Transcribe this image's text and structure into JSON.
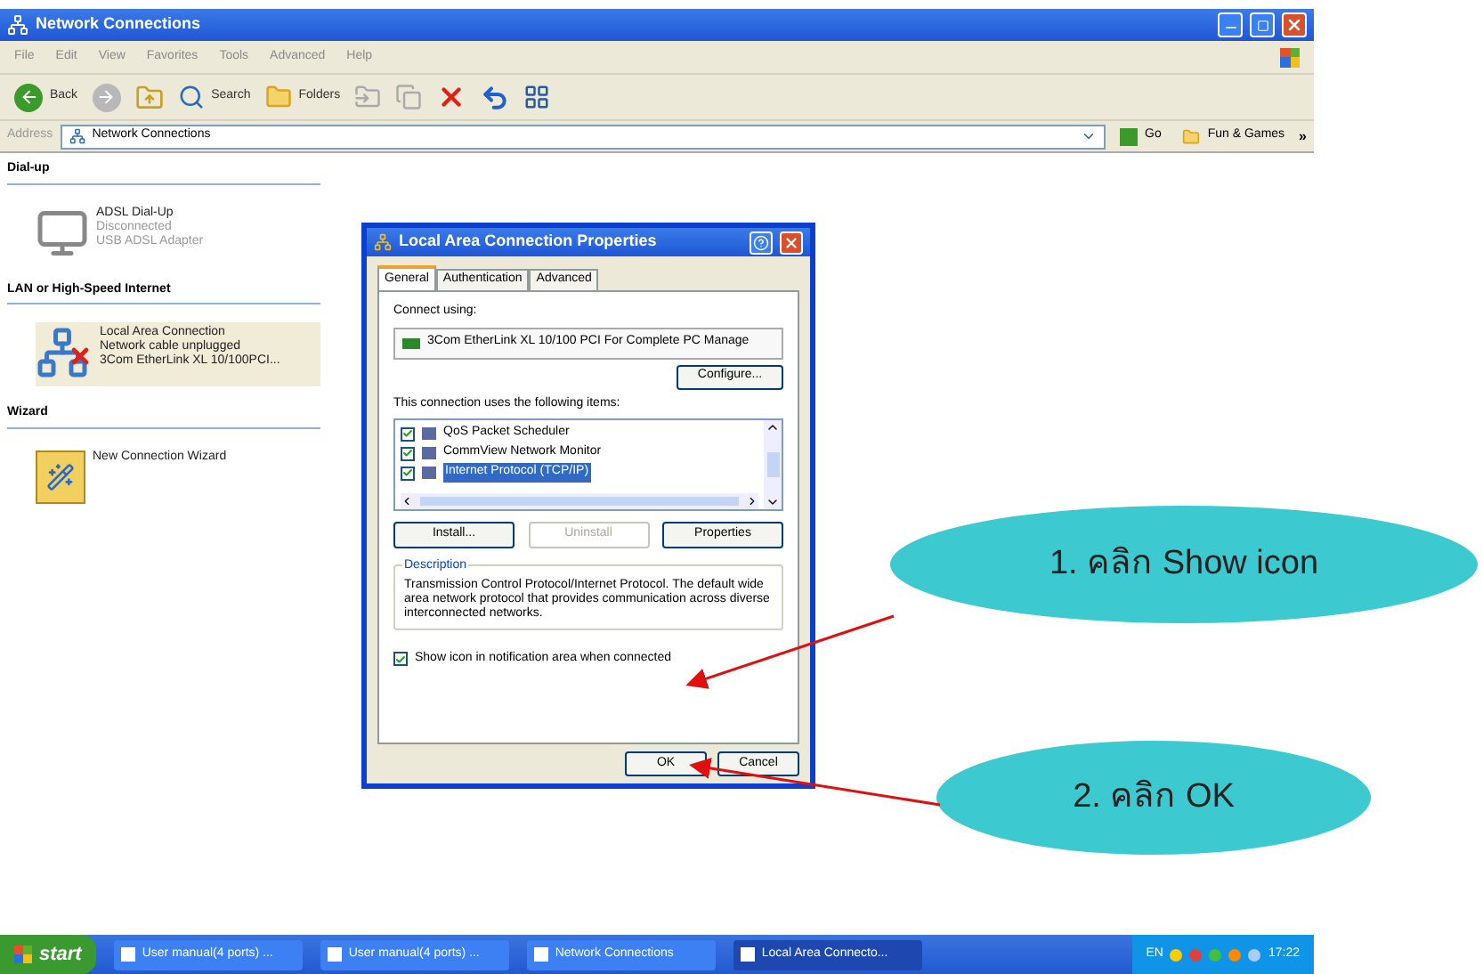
{
  "window": {
    "title": "Network Connections"
  },
  "menu": [
    "File",
    "Edit",
    "View",
    "Favorites",
    "Tools",
    "Advanced",
    "Help"
  ],
  "toolbar": [
    {
      "kind": "back",
      "label": "Back"
    },
    {
      "kind": "forward"
    },
    {
      "kind": "up"
    },
    {
      "kind": "search",
      "label": "Search"
    },
    {
      "kind": "folders",
      "label": "Folders"
    },
    {
      "kind": "move"
    },
    {
      "kind": "copy"
    },
    {
      "kind": "delete"
    },
    {
      "kind": "undo"
    },
    {
      "kind": "views"
    }
  ],
  "address": {
    "label": "Address",
    "value": "Network Connections",
    "go": "Go",
    "link": "Fun & Games",
    "more": "»"
  },
  "groups": [
    {
      "heading": "Dial-up",
      "items": [
        {
          "kind": "dialup",
          "selected": false,
          "lines": [
            "ADSL Dial-Up",
            "Disconnected",
            "USB ADSL Adapter"
          ]
        }
      ]
    },
    {
      "heading": "LAN or High-Speed Internet",
      "items": [
        {
          "kind": "lan",
          "selected": true,
          "lines": [
            "Local Area Connection",
            "Network cable unplugged",
            "3Com EtherLink XL 10/100PCI..."
          ]
        }
      ]
    },
    {
      "heading": "Wizard",
      "items": [
        {
          "kind": "wizard",
          "selected": false,
          "lines": [
            "New Connection Wizard"
          ]
        }
      ]
    }
  ],
  "dialog": {
    "title": "Local Area Connection Properties",
    "tabs": [
      {
        "label": "General",
        "selected": true
      },
      {
        "label": "Authentication",
        "selected": false
      },
      {
        "label": "Advanced",
        "selected": false
      }
    ],
    "connect_label": "Connect using:",
    "adapter": "3Com EtherLink XL 10/100 PCI For Complete PC Manage",
    "configure": "Configure...",
    "items_label": "This connection uses the following items:",
    "items": [
      {
        "label": "QoS Packet Scheduler",
        "checked": true,
        "selected": false
      },
      {
        "label": "CommView Network Monitor",
        "checked": true,
        "selected": false
      },
      {
        "label": "Internet Protocol (TCP/IP)",
        "checked": true,
        "selected": true
      }
    ],
    "buttons": [
      {
        "label": "Install...",
        "disabled": false
      },
      {
        "label": "Uninstall",
        "disabled": true
      },
      {
        "label": "Properties",
        "disabled": false
      }
    ],
    "description_label": "Description",
    "description": "Transmission Control Protocol/Internet Protocol. The default wide area network protocol that provides communication across diverse interconnected networks.",
    "show_icon": {
      "label": "Show icon in notification area when connected",
      "checked": true
    },
    "ok": "OK",
    "cancel": "Cancel"
  },
  "taskbar": {
    "start": "start",
    "tasks": [
      {
        "label": "User manual(4 ports) ...",
        "selected": false
      },
      {
        "label": "User manual(4 ports) ...",
        "selected": false
      },
      {
        "label": "Network Connections",
        "selected": false
      },
      {
        "label": "Local Area Connecto...",
        "selected": true
      }
    ],
    "language": "EN",
    "clock": "17:22"
  },
  "callouts": [
    {
      "text": "1. คลิก Show icon"
    },
    {
      "text": "2. คลิก OK"
    }
  ]
}
